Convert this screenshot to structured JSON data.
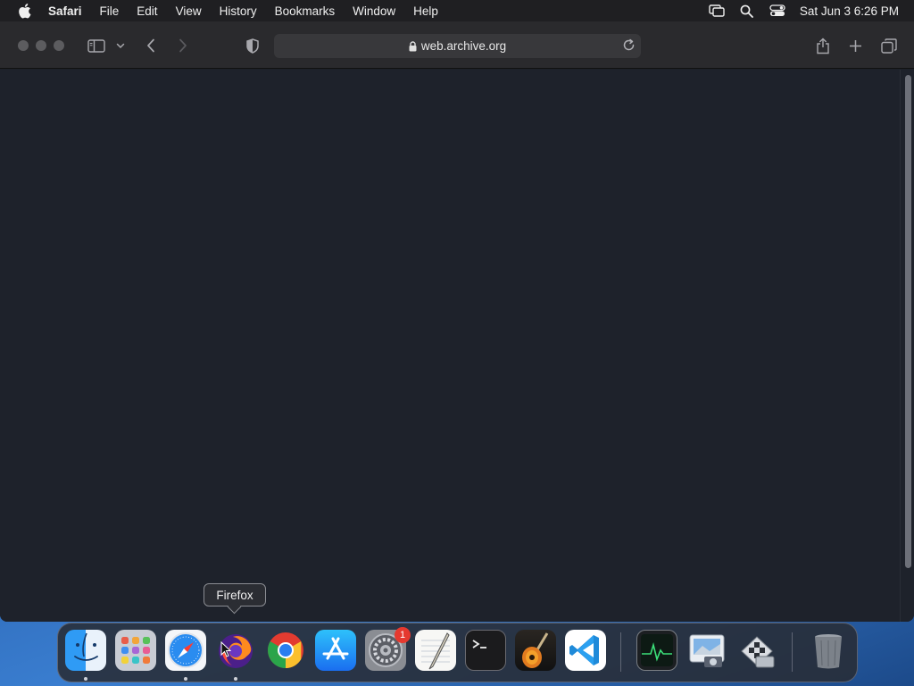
{
  "menubar": {
    "app_name": "Safari",
    "items": [
      "File",
      "Edit",
      "View",
      "History",
      "Bookmarks",
      "Window",
      "Help"
    ],
    "clock": "Sat Jun 3  6:26 PM",
    "icons": [
      "apple-icon",
      "screen-mirroring-icon",
      "spotlight-search-icon",
      "control-center-icon"
    ]
  },
  "toolbar": {
    "address": "web.archive.org",
    "icons": [
      "sidebar-icon",
      "chevron-down-icon",
      "back-icon",
      "forward-icon",
      "privacy-shield-icon",
      "lock-icon",
      "reload-icon",
      "share-icon",
      "new-tab-icon",
      "tab-overview-icon"
    ]
  },
  "tooltip": {
    "label": "Firefox"
  },
  "dock": {
    "apps": [
      {
        "name": "Finder",
        "icon": "finder-icon",
        "running": true
      },
      {
        "name": "Launchpad",
        "icon": "launchpad-icon",
        "running": false
      },
      {
        "name": "Safari",
        "icon": "safari-icon",
        "running": true
      },
      {
        "name": "Firefox",
        "icon": "firefox-icon",
        "running": true
      },
      {
        "name": "Google Chrome",
        "icon": "chrome-icon",
        "running": false
      },
      {
        "name": "App Store",
        "icon": "app-store-icon",
        "running": false
      },
      {
        "name": "System Preferences",
        "icon": "system-preferences-icon",
        "running": false,
        "badge": "1"
      },
      {
        "name": "TextEdit",
        "icon": "textedit-icon",
        "running": false
      },
      {
        "name": "Terminal",
        "icon": "terminal-icon",
        "running": false
      },
      {
        "name": "GarageBand",
        "icon": "garageband-icon",
        "running": false
      },
      {
        "name": "Visual Studio Code",
        "icon": "vscode-icon",
        "running": false
      },
      {
        "name": "Activity Monitor",
        "icon": "activity-monitor-icon",
        "running": false
      },
      {
        "name": "Preview",
        "icon": "preview-icon",
        "running": false
      },
      {
        "name": "Boot Camp Assistant",
        "icon": "boot-camp-icon",
        "running": false
      },
      {
        "name": "Trash",
        "icon": "trash-icon",
        "running": false
      }
    ]
  },
  "colors": {
    "menubar": "#1f1f22",
    "toolbar": "#2a2a2d",
    "content": "#1e222b",
    "badge": "#e5392f"
  }
}
